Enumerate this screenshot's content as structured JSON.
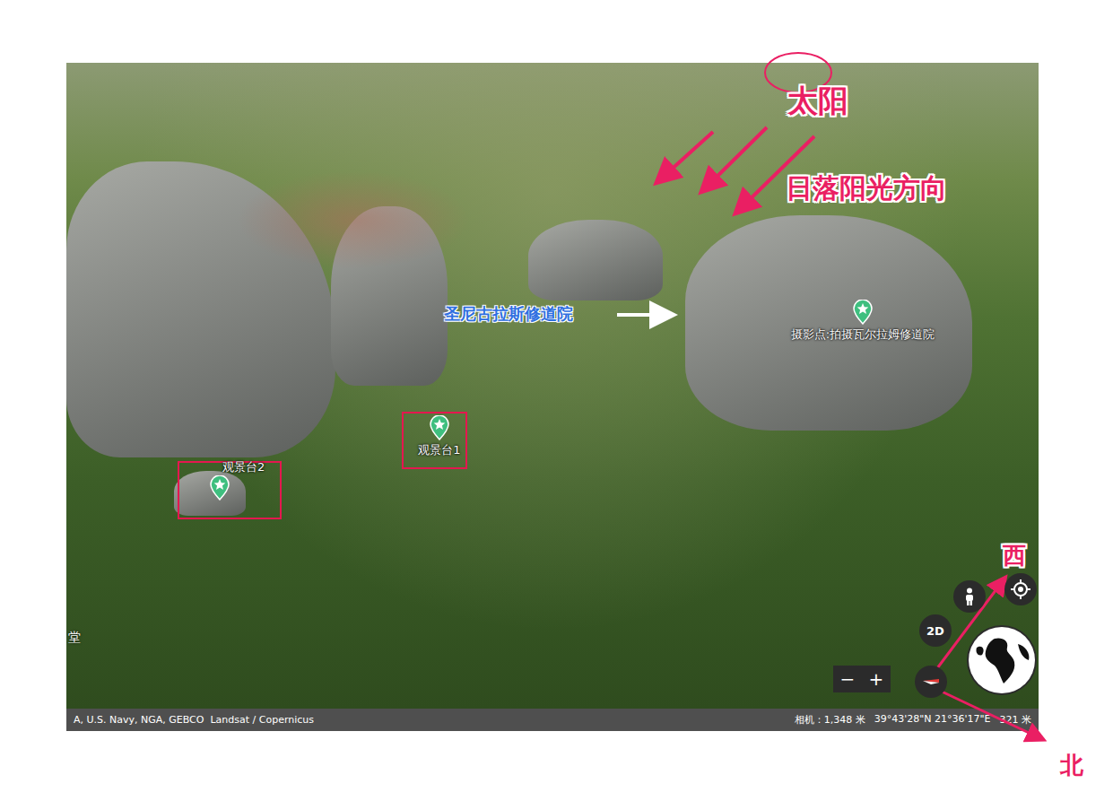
{
  "map": {
    "attribution": "A, U.S. Navy, NGA, GEBCO  Landsat / Copernicus",
    "camera": "相机：1,348 米",
    "coordinates": "39°43'28\"N 21°36'17\"E",
    "altitude": "321 米",
    "edge_label": "堂"
  },
  "controls": {
    "mode_button": "2D",
    "zoom_out": "−",
    "zoom_in": "+"
  },
  "placemarks": [
    {
      "label": "摄影点:拍摄瓦尔拉姆修道院",
      "highlighted": false
    },
    {
      "label": "观景台1",
      "highlighted": true
    },
    {
      "label": "观景台2",
      "highlighted": true
    }
  ],
  "annotations": {
    "sun": "太阳",
    "sunlight": "日落阳光方向",
    "monastery": "圣尼古拉斯修道院",
    "west": "西",
    "north": "北"
  }
}
